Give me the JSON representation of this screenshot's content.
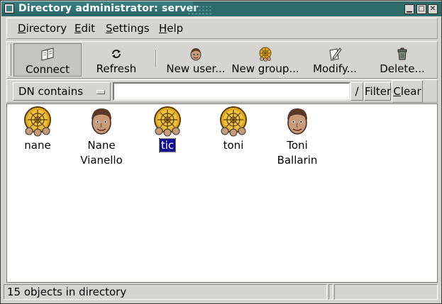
{
  "window": {
    "title": "Directory administrator: server",
    "controls": {
      "minimize": "▁",
      "maximize": "□",
      "close": "✕"
    }
  },
  "menu": {
    "items": [
      {
        "first": "D",
        "rest": "irectory"
      },
      {
        "first": "E",
        "rest": "dit"
      },
      {
        "first": "S",
        "rest": "ettings"
      },
      {
        "first": "H",
        "rest": "elp"
      }
    ]
  },
  "toolbar": {
    "connect": {
      "label": "Connect",
      "icon": "book-open-icon"
    },
    "refresh": {
      "label": "Refresh",
      "icon": "refresh-arrows-icon"
    },
    "new_user": {
      "label": "New user...",
      "icon": "user-face-icon"
    },
    "new_group": {
      "label": "New group...",
      "icon": "group-web-icon"
    },
    "modify": {
      "label": "Modify...",
      "icon": "pencil-paper-icon"
    },
    "delete": {
      "label": "Delete...",
      "icon": "trash-can-icon"
    }
  },
  "filter": {
    "mode": "DN contains",
    "search_value": "",
    "pick_label": "/",
    "filter_label": "Filter",
    "clear_first": "C",
    "clear_rest": "lear"
  },
  "objects": [
    {
      "line1": "nane",
      "line2": "",
      "kind": "group",
      "selected": false
    },
    {
      "line1": "Nane",
      "line2": "Vianello",
      "kind": "user",
      "selected": false
    },
    {
      "line1": "tic",
      "line2": "",
      "kind": "group",
      "selected": true
    },
    {
      "line1": "toni",
      "line2": "",
      "kind": "group",
      "selected": false
    },
    {
      "line1": "Toni",
      "line2": "Ballarin",
      "kind": "user",
      "selected": false
    }
  ],
  "status": {
    "text": "15 objects in directory"
  },
  "colors": {
    "titlebar": "#2e6b6b",
    "selection": "#0b0b8f",
    "group_gold": "#e0a820",
    "face_skin": "#c89a78"
  }
}
